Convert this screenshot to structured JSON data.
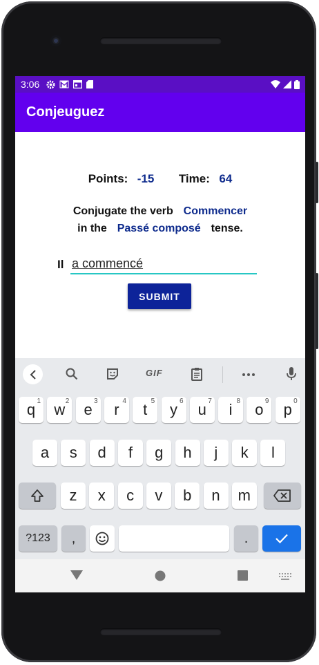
{
  "status_bar": {
    "time": "3:06",
    "left_icons": [
      "gear-icon",
      "gmail-icon",
      "calendar-icon",
      "sd-card-icon"
    ],
    "right_icons": [
      "wifi-icon",
      "signal-icon",
      "battery-icon"
    ],
    "color": "#5a0fc4"
  },
  "app_bar": {
    "title": "Conjeuguez",
    "color": "#6200ee"
  },
  "game": {
    "points_label": "Points:",
    "points_value": "-15",
    "time_label": "Time:",
    "time_value": "64",
    "conjugate_prefix": "Conjugate the verb",
    "verb": "Commencer",
    "in_the": "in the",
    "tense": "Passé composé",
    "tense_suffix": "tense.",
    "pronoun": "Il",
    "answer_value": "a commencé",
    "submit_label": "SUBMIT",
    "accent_color": "#0d2a8c"
  },
  "keyboard": {
    "toolbar_icons": [
      "chevron-left-icon",
      "search-icon",
      "sticker-icon",
      "gif-icon",
      "clipboard-icon",
      "more-icon",
      "mic-icon"
    ],
    "gif_label": "GIF",
    "row1": [
      {
        "k": "q",
        "h": "1"
      },
      {
        "k": "w",
        "h": "2"
      },
      {
        "k": "e",
        "h": "3"
      },
      {
        "k": "r",
        "h": "4"
      },
      {
        "k": "t",
        "h": "5"
      },
      {
        "k": "y",
        "h": "6"
      },
      {
        "k": "u",
        "h": "7"
      },
      {
        "k": "i",
        "h": "8"
      },
      {
        "k": "o",
        "h": "9"
      },
      {
        "k": "p",
        "h": "0"
      }
    ],
    "row2": [
      "a",
      "s",
      "d",
      "f",
      "g",
      "h",
      "j",
      "k",
      "l"
    ],
    "row3": [
      "z",
      "x",
      "c",
      "v",
      "b",
      "n",
      "m"
    ],
    "symbols_label": "?123",
    "comma_label": ",",
    "period_label": ".",
    "action_color": "#1a73e8"
  },
  "nav_bar": {
    "icons": [
      "back-icon",
      "home-icon",
      "recents-icon",
      "keyboard-switch-icon"
    ]
  }
}
